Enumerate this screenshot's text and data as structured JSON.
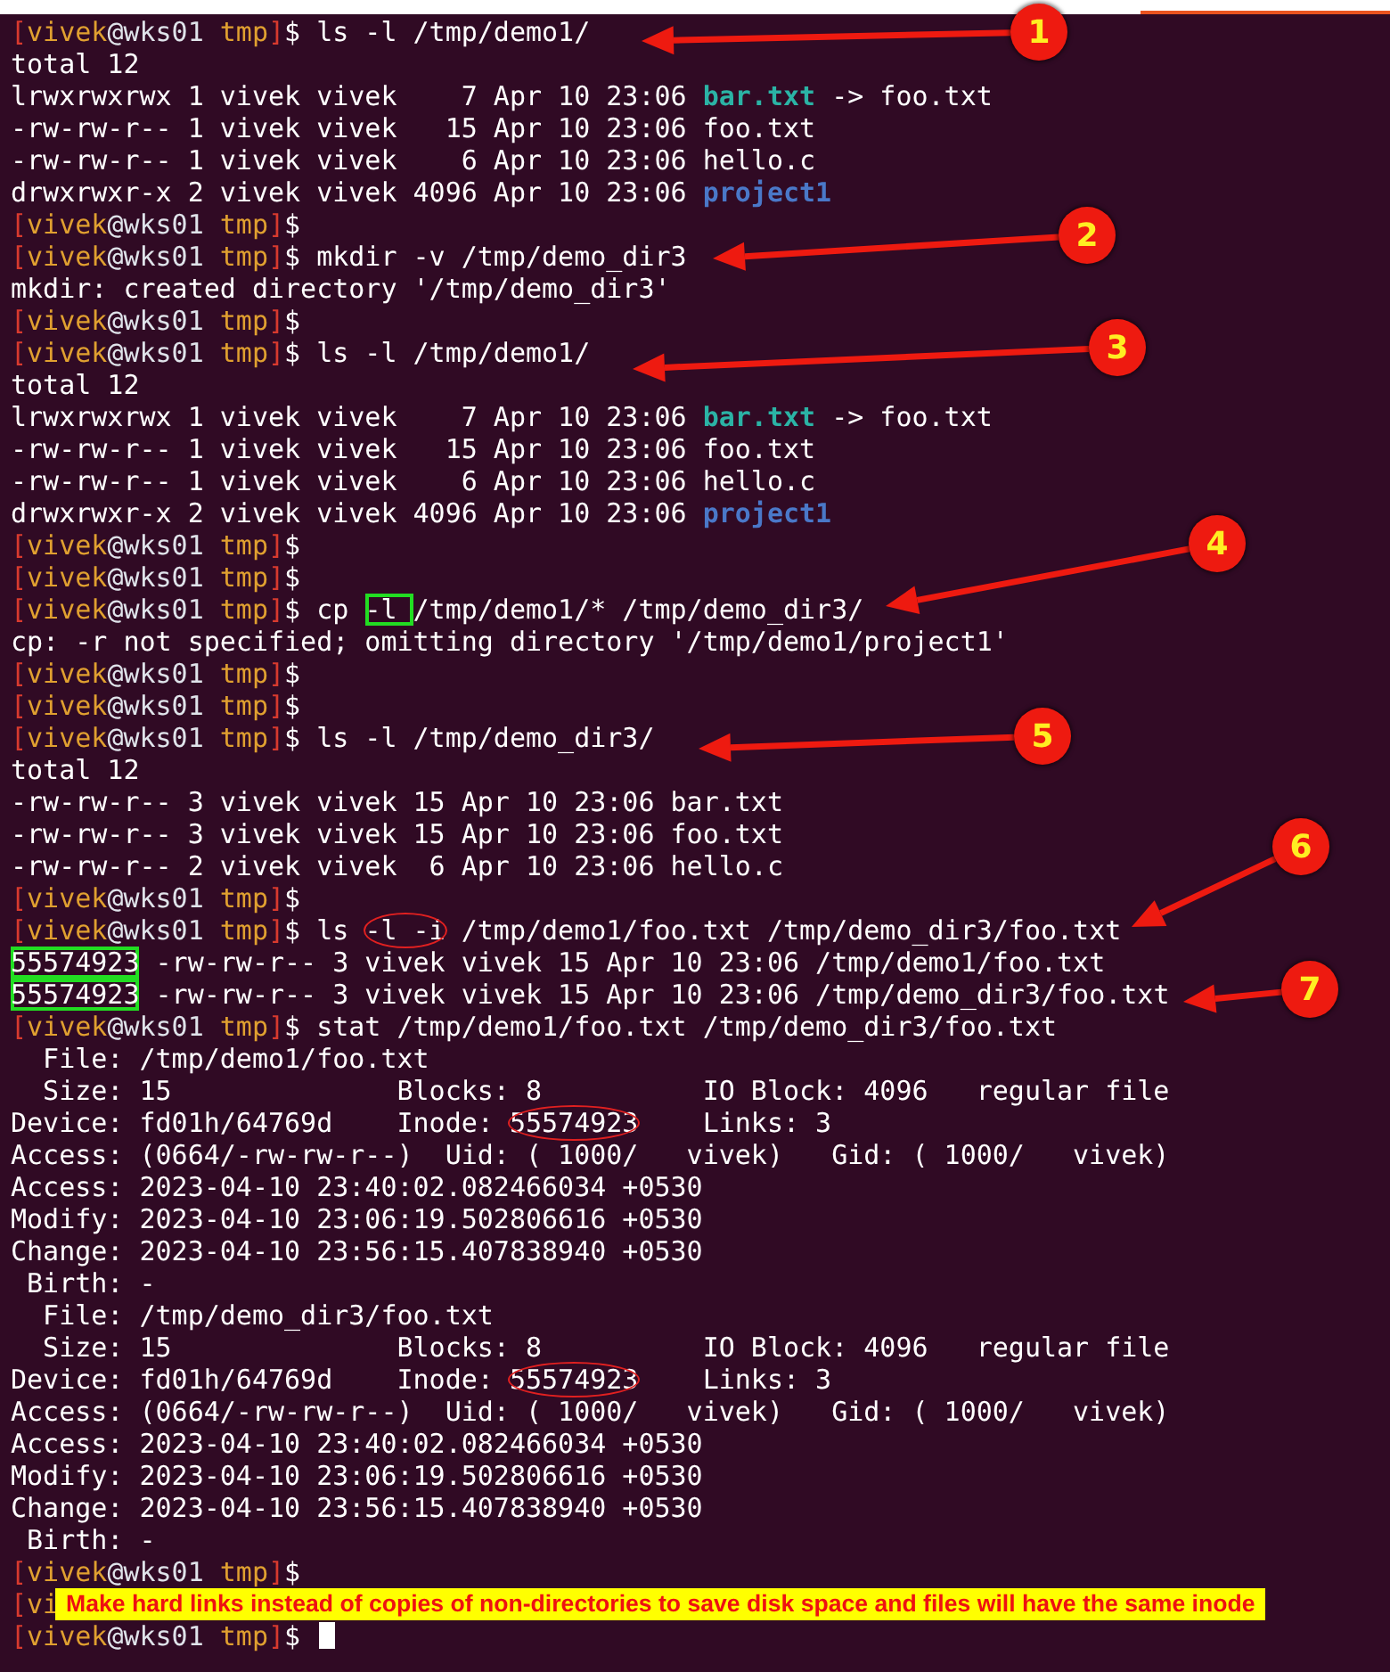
{
  "lines": [
    {
      "prompt": {
        "open": "[",
        "user": "vivek",
        "host": "@wks01",
        "dir": " tmp",
        "close": "]",
        "sigil": "$"
      },
      "segments": [
        {
          "text": " ls -l /tmp/demo1/"
        }
      ]
    },
    {
      "segments": [
        {
          "text": "total 12"
        }
      ]
    },
    {
      "segments": [
        {
          "text": "lrwxrwxrwx 1 vivek vivek    7 Apr 10 23:06 "
        },
        {
          "text": "bar.txt",
          "kind": "symlink"
        },
        {
          "text": " -> foo.txt"
        }
      ]
    },
    {
      "segments": [
        {
          "text": "-rw-rw-r-- 1 vivek vivek   15 Apr 10 23:06 foo.txt"
        }
      ]
    },
    {
      "segments": [
        {
          "text": "-rw-rw-r-- 1 vivek vivek    6 Apr 10 23:06 hello.c"
        }
      ]
    },
    {
      "segments": [
        {
          "text": "drwxrwxr-x 2 vivek vivek 4096 Apr 10 23:06 "
        },
        {
          "text": "project1",
          "kind": "directory"
        }
      ]
    },
    {
      "prompt": {
        "open": "[",
        "user": "vivek",
        "host": "@wks01",
        "dir": " tmp",
        "close": "]",
        "sigil": "$"
      }
    },
    {
      "prompt": {
        "open": "[",
        "user": "vivek",
        "host": "@wks01",
        "dir": " tmp",
        "close": "]",
        "sigil": "$"
      },
      "segments": [
        {
          "text": " mkdir -v /tmp/demo_dir3"
        }
      ]
    },
    {
      "segments": [
        {
          "text": "mkdir: created directory '/tmp/demo_dir3'"
        }
      ]
    },
    {
      "prompt": {
        "open": "[",
        "user": "vivek",
        "host": "@wks01",
        "dir": " tmp",
        "close": "]",
        "sigil": "$"
      }
    },
    {
      "prompt": {
        "open": "[",
        "user": "vivek",
        "host": "@wks01",
        "dir": " tmp",
        "close": "]",
        "sigil": "$"
      },
      "segments": [
        {
          "text": " ls -l /tmp/demo1/"
        }
      ]
    },
    {
      "segments": [
        {
          "text": "total 12"
        }
      ]
    },
    {
      "segments": [
        {
          "text": "lrwxrwxrwx 1 vivek vivek    7 Apr 10 23:06 "
        },
        {
          "text": "bar.txt",
          "kind": "symlink"
        },
        {
          "text": " -> foo.txt"
        }
      ]
    },
    {
      "segments": [
        {
          "text": "-rw-rw-r-- 1 vivek vivek   15 Apr 10 23:06 foo.txt"
        }
      ]
    },
    {
      "segments": [
        {
          "text": "-rw-rw-r-- 1 vivek vivek    6 Apr 10 23:06 hello.c"
        }
      ]
    },
    {
      "segments": [
        {
          "text": "drwxrwxr-x 2 vivek vivek 4096 Apr 10 23:06 "
        },
        {
          "text": "project1",
          "kind": "directory"
        }
      ]
    },
    {
      "prompt": {
        "open": "[",
        "user": "vivek",
        "host": "@wks01",
        "dir": " tmp",
        "close": "]",
        "sigil": "$"
      }
    },
    {
      "prompt": {
        "open": "[",
        "user": "vivek",
        "host": "@wks01",
        "dir": " tmp",
        "close": "]",
        "sigil": "$"
      }
    },
    {
      "prompt": {
        "open": "[",
        "user": "vivek",
        "host": "@wks01",
        "dir": " tmp",
        "close": "]",
        "sigil": "$"
      },
      "segments": [
        {
          "text": " cp "
        },
        {
          "text": "-l ",
          "boxed": true
        },
        {
          "text": "/tmp/demo1/* /tmp/demo_dir3/"
        }
      ]
    },
    {
      "segments": [
        {
          "text": "cp: -r not specified; omitting directory '/tmp/demo1/project1'"
        }
      ]
    },
    {
      "prompt": {
        "open": "[",
        "user": "vivek",
        "host": "@wks01",
        "dir": " tmp",
        "close": "]",
        "sigil": "$"
      }
    },
    {
      "prompt": {
        "open": "[",
        "user": "vivek",
        "host": "@wks01",
        "dir": " tmp",
        "close": "]",
        "sigil": "$"
      }
    },
    {
      "prompt": {
        "open": "[",
        "user": "vivek",
        "host": "@wks01",
        "dir": " tmp",
        "close": "]",
        "sigil": "$"
      },
      "segments": [
        {
          "text": " ls -l /tmp/demo_dir3/"
        }
      ]
    },
    {
      "segments": [
        {
          "text": "total 12"
        }
      ]
    },
    {
      "segments": [
        {
          "text": "-rw-rw-r-- 3 vivek vivek 15 Apr 10 23:06 bar.txt"
        }
      ]
    },
    {
      "segments": [
        {
          "text": "-rw-rw-r-- 3 vivek vivek 15 Apr 10 23:06 foo.txt"
        }
      ]
    },
    {
      "segments": [
        {
          "text": "-rw-rw-r-- 2 vivek vivek  6 Apr 10 23:06 hello.c"
        }
      ]
    },
    {
      "prompt": {
        "open": "[",
        "user": "vivek",
        "host": "@wks01",
        "dir": " tmp",
        "close": "]",
        "sigil": "$"
      }
    },
    {
      "prompt": {
        "open": "[",
        "user": "vivek",
        "host": "@wks01",
        "dir": " tmp",
        "close": "]",
        "sigil": "$"
      },
      "segments": [
        {
          "text": " ls "
        },
        {
          "text": "-l -i",
          "circled": true
        },
        {
          "text": " /tmp/demo1/foo.txt /tmp/demo_dir3/foo.txt"
        }
      ]
    },
    {
      "segments": [
        {
          "text": "55574923",
          "boxed": true
        },
        {
          "text": " -rw-rw-r-- 3 vivek vivek 15 Apr 10 23:06 /tmp/demo1/foo.txt"
        }
      ]
    },
    {
      "segments": [
        {
          "text": "55574923",
          "boxed": true
        },
        {
          "text": " -rw-rw-r-- 3 vivek vivek 15 Apr 10 23:06 /tmp/demo_dir3/foo.txt"
        }
      ]
    },
    {
      "prompt": {
        "open": "[",
        "user": "vivek",
        "host": "@wks01",
        "dir": " tmp",
        "close": "]",
        "sigil": "$"
      },
      "segments": [
        {
          "text": " stat /tmp/demo1/foo.txt /tmp/demo_dir3/foo.txt"
        }
      ]
    },
    {
      "segments": [
        {
          "text": "  File: /tmp/demo1/foo.txt"
        }
      ]
    },
    {
      "segments": [
        {
          "text": "  Size: 15              Blocks: 8          IO Block: 4096   regular file"
        }
      ]
    },
    {
      "segments": [
        {
          "text": "Device: fd01h/64769d    Inode: "
        },
        {
          "text": "55574923",
          "circled": true
        },
        {
          "text": "    Links: 3"
        }
      ]
    },
    {
      "segments": [
        {
          "text": "Access: (0664/-rw-rw-r--)  Uid: ( 1000/   vivek)   Gid: ( 1000/   vivek)"
        }
      ]
    },
    {
      "segments": [
        {
          "text": "Access: 2023-04-10 23:40:02.082466034 +0530"
        }
      ]
    },
    {
      "segments": [
        {
          "text": "Modify: 2023-04-10 23:06:19.502806616 +0530"
        }
      ]
    },
    {
      "segments": [
        {
          "text": "Change: 2023-04-10 23:56:15.407838940 +0530"
        }
      ]
    },
    {
      "segments": [
        {
          "text": " Birth: -"
        }
      ]
    },
    {
      "segments": [
        {
          "text": "  File: /tmp/demo_dir3/foo.txt"
        }
      ]
    },
    {
      "segments": [
        {
          "text": "  Size: 15              Blocks: 8          IO Block: 4096   regular file"
        }
      ]
    },
    {
      "segments": [
        {
          "text": "Device: fd01h/64769d    Inode: "
        },
        {
          "text": "55574923",
          "circled": true
        },
        {
          "text": "    Links: 3"
        }
      ]
    },
    {
      "segments": [
        {
          "text": "Access: (0664/-rw-rw-r--)  Uid: ( 1000/   vivek)   Gid: ( 1000/   vivek)"
        }
      ]
    },
    {
      "segments": [
        {
          "text": "Access: 2023-04-10 23:40:02.082466034 +0530"
        }
      ]
    },
    {
      "segments": [
        {
          "text": "Modify: 2023-04-10 23:06:19.502806616 +0530"
        }
      ]
    },
    {
      "segments": [
        {
          "text": "Change: 2023-04-10 23:56:15.407838940 +0530"
        }
      ]
    },
    {
      "segments": [
        {
          "text": " Birth: -"
        }
      ]
    },
    {
      "prompt": {
        "open": "[",
        "user": "vivek",
        "host": "@wks01",
        "dir": " tmp",
        "close": "]",
        "sigil": "$"
      }
    },
    {
      "prompt": {
        "open": "[",
        "user": "vi"
      }
    },
    {
      "prompt": {
        "open": "[",
        "user": "vivek",
        "host": "@wks01",
        "dir": " tmp",
        "close": "]",
        "sigil": "$"
      },
      "cursor": true
    }
  ],
  "callouts": [
    {
      "number": "1"
    },
    {
      "number": "2"
    },
    {
      "number": "3"
    },
    {
      "number": "4"
    },
    {
      "number": "5"
    },
    {
      "number": "6"
    },
    {
      "number": "7"
    }
  ],
  "caption": {
    "text": "Make hard links instead of copies of non-directories to save disk space and files will have the same inode"
  }
}
